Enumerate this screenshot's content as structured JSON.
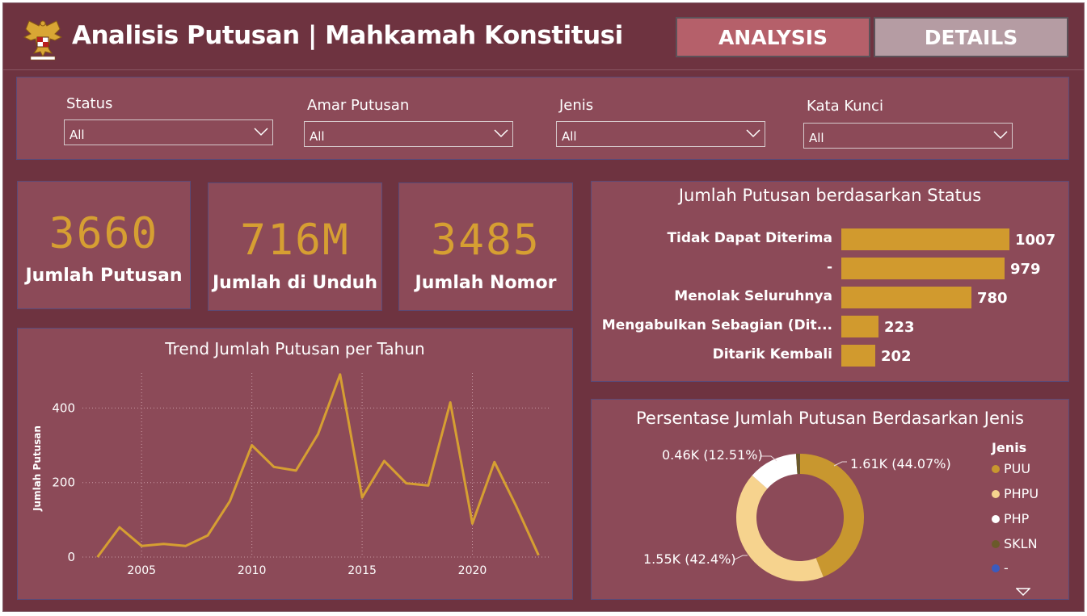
{
  "header": {
    "title": "Analisis Putusan | Mahkamah Konstitusi",
    "nav": [
      {
        "label": "ANALYSIS",
        "color": "#b5606a"
      },
      {
        "label": "DETAILS",
        "color": "#b59ca3"
      }
    ]
  },
  "filters": [
    {
      "label": "Status",
      "value": "All"
    },
    {
      "label": "Amar Putusan",
      "value": "All"
    },
    {
      "label": "Jenis",
      "value": "All"
    },
    {
      "label": "Kata Kunci",
      "value": "All"
    }
  ],
  "kpis": [
    {
      "value": "3660",
      "label": "Jumlah Putusan"
    },
    {
      "value": "716M",
      "label": "Jumlah di Unduh"
    },
    {
      "value": "3485",
      "label": "Jumlah Nomor"
    }
  ],
  "colors": {
    "background": "#6e3340",
    "panel": "#8c4a58",
    "accent": "#d19a2e",
    "line": "#d69f32"
  },
  "chart_data": [
    {
      "type": "bar",
      "orientation": "horizontal",
      "title": "Jumlah Putusan berdasarkan Status",
      "categories": [
        "Tidak Dapat Diterima",
        "-",
        "Menolak Seluruhnya",
        "Mengabulkan Sebagian (Dit...",
        "Ditarik Kembali"
      ],
      "values": [
        1007,
        979,
        780,
        223,
        202
      ]
    },
    {
      "type": "line",
      "title": "Trend Jumlah Putusan per Tahun",
      "xlabel": "",
      "ylabel": "Jumlah Putusan",
      "x": [
        2003,
        2004,
        2005,
        2006,
        2007,
        2008,
        2009,
        2010,
        2011,
        2012,
        2013,
        2014,
        2015,
        2016,
        2017,
        2018,
        2019,
        2020,
        2021,
        2022,
        2023
      ],
      "y": [
        0,
        80,
        30,
        35,
        30,
        58,
        150,
        300,
        242,
        232,
        330,
        490,
        160,
        258,
        198,
        192,
        415,
        90,
        255,
        135,
        5
      ],
      "xticks": [
        "2005",
        "2010",
        "2015",
        "2020"
      ],
      "yticks": [
        "0",
        "200",
        "400"
      ],
      "xlim": [
        2002.5,
        2023.5
      ],
      "ylim": [
        0,
        520
      ],
      "grid": true
    },
    {
      "type": "pie",
      "variant": "donut",
      "title": "Persentase Jumlah Putusan Berdasarkan Jenis",
      "legend_title": "Jenis",
      "legend_position": "right",
      "slices": [
        {
          "name": "PUU",
          "value": 44.07,
          "label": "1.61K (44.07%)",
          "color": "#c8972f"
        },
        {
          "name": "PHPU",
          "value": 42.4,
          "label": "1.55K (42.4%)",
          "color": "#f6d38e"
        },
        {
          "name": "PHP",
          "value": 12.51,
          "label": "0.46K (12.51%)",
          "color": "#ffffff"
        },
        {
          "name": "SKLN",
          "value": 1.0,
          "label": "",
          "color": "#6b5a2a"
        },
        {
          "name": "-",
          "value": 0.02,
          "label": "",
          "color": "#3a5bbf"
        }
      ]
    }
  ]
}
